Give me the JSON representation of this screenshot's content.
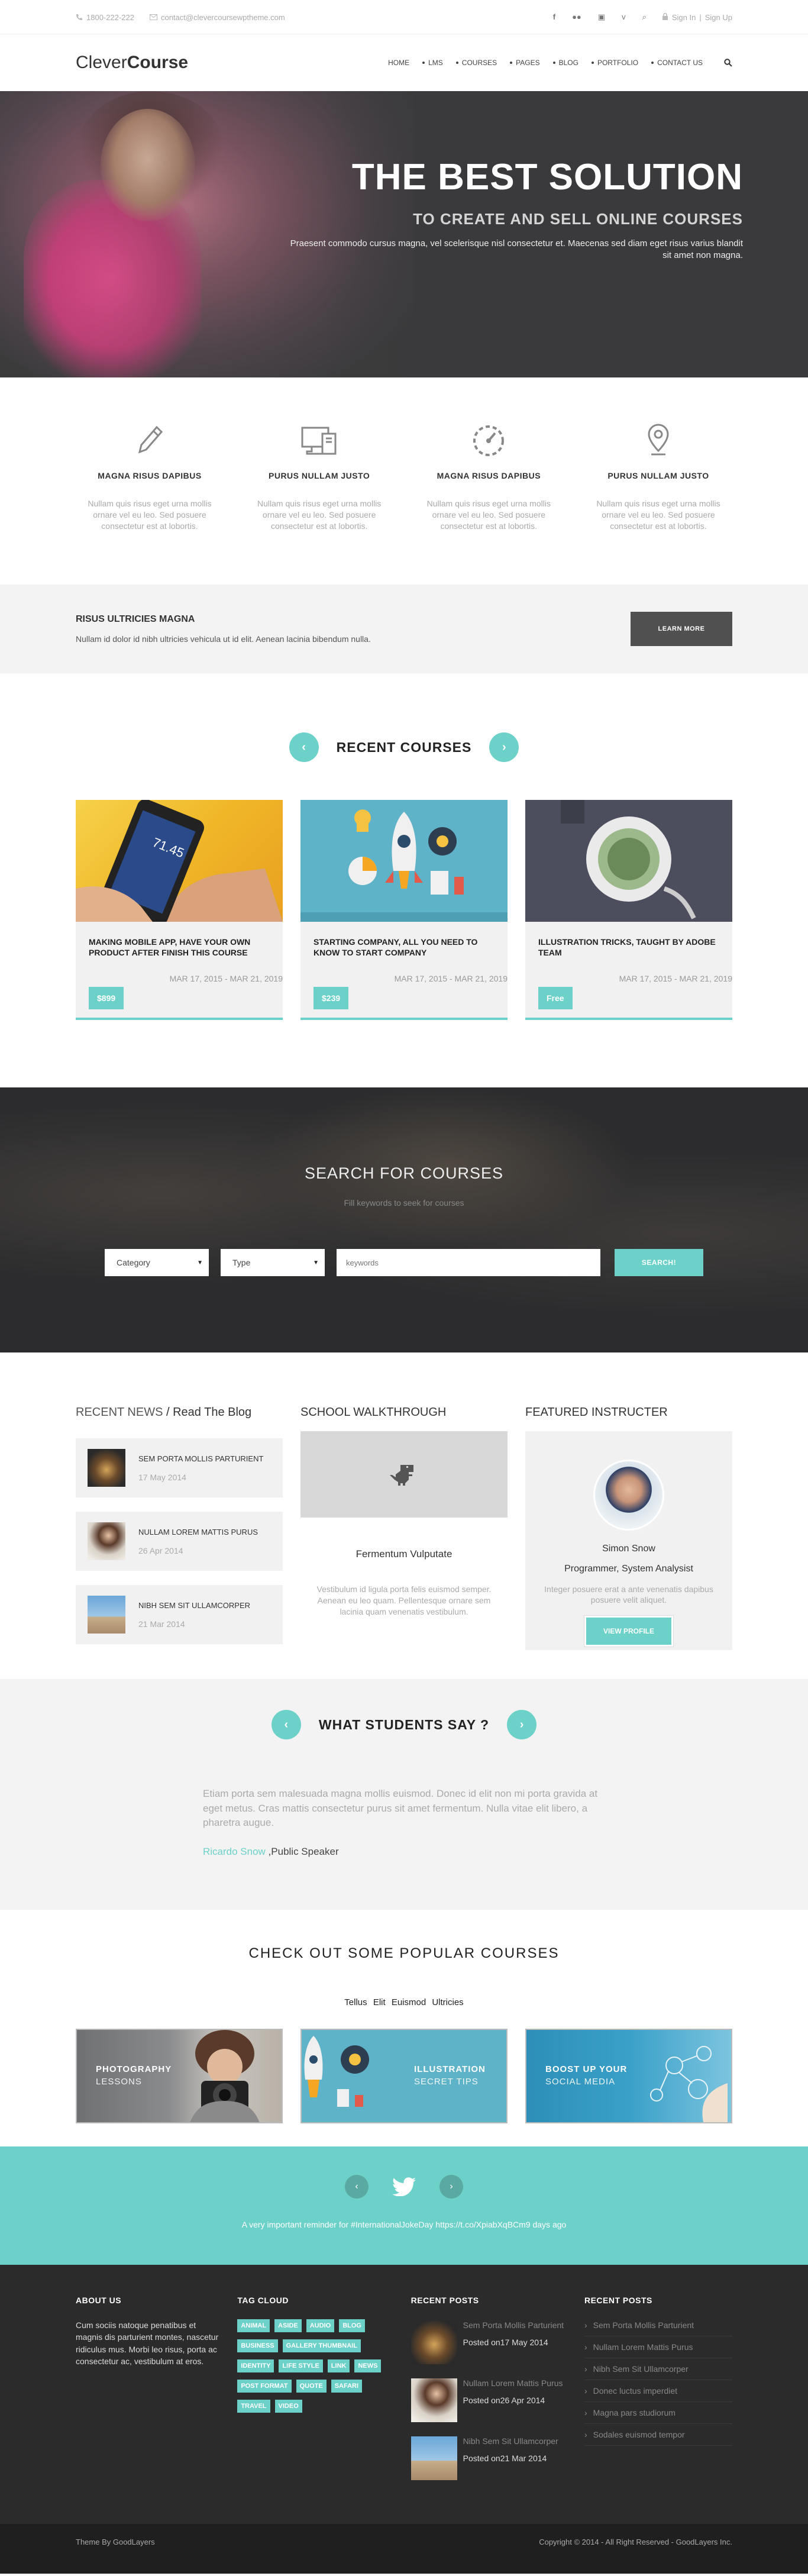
{
  "topbar": {
    "phone": "1800-222-222",
    "email": "contact@clevercoursewptheme.com",
    "sign_in": "Sign In",
    "separator": "|",
    "sign_up": "Sign Up",
    "social_icons": [
      "facebook-icon",
      "flickr-icon",
      "linkedin-icon",
      "vimeo-icon",
      "search-icon"
    ]
  },
  "header": {
    "logo_light": "Clever",
    "logo_bold": "Course",
    "nav": [
      "HOME",
      "LMS",
      "COURSES",
      "PAGES",
      "BLOG",
      "PORTFOLIO",
      "CONTACT US"
    ]
  },
  "hero": {
    "title": "THE BEST SOLUTION",
    "subtitle": "TO CREATE AND SELL ONLINE COURSES",
    "text": "Praesent commodo cursus magna, vel scelerisque nisl consectetur et. Maecenas sed diam eget risus varius blandit sit amet non magna."
  },
  "features": [
    {
      "icon": "pencil-icon",
      "title": "MAGNA RISUS DAPIBUS",
      "text": "Nullam quis risus eget urna mollis ornare vel eu leo. Sed posuere consectetur est at lobortis."
    },
    {
      "icon": "desktop-icon",
      "title": "PURUS NULLAM JUSTO",
      "text": "Nullam quis risus eget urna mollis ornare vel eu leo. Sed posuere consectetur est at lobortis."
    },
    {
      "icon": "dashboard-icon",
      "title": "MAGNA RISUS DAPIBUS",
      "text": "Nullam quis risus eget urna mollis ornare vel eu leo. Sed posuere consectetur est at lobortis."
    },
    {
      "icon": "location-pin-icon",
      "title": "PURUS NULLAM JUSTO",
      "text": "Nullam quis risus eget urna mollis ornare vel eu leo. Sed posuere consectetur est at lobortis."
    }
  ],
  "promo": {
    "title": "RISUS ULTRICIES MAGNA",
    "text": "Nullam id dolor id nibh ultricies vehicula ut id elit. Aenean lacinia bibendum nulla.",
    "button": "LEARN MORE"
  },
  "courses": {
    "title": "RECENT COURSES",
    "prev": "‹",
    "next": "›",
    "items": [
      {
        "title": "MAKING MOBILE APP, HAVE YOUR OWN PRODUCT AFTER FINISH THIS COURSE",
        "date": "MAR 17, 2015 - MAR 21, 2019",
        "price": "$899"
      },
      {
        "title": "STARTING COMPANY, ALL YOU NEED TO KNOW TO START COMPANY",
        "date": "MAR 17, 2015 - MAR 21, 2019",
        "price": "$239"
      },
      {
        "title": "ILLUSTRATION TRICKS, TAUGHT BY ADOBE TEAM",
        "date": "MAR 17, 2015 - MAR 21, 2019",
        "price": "Free"
      }
    ]
  },
  "search": {
    "title": "SEARCH FOR COURSES",
    "subtitle": "Fill keywords to seek for courses",
    "category": "Category",
    "type": "Type",
    "keywords_placeholder": "keywords",
    "button": "SEARCH!"
  },
  "news": {
    "title": "RECENT NEWS",
    "link": " / Read The Blog",
    "items": [
      {
        "title": "SEM PORTA MOLLIS PARTURIENT",
        "date": "17 May 2014"
      },
      {
        "title": "NULLAM LOREM MATTIS PURUS",
        "date": "26 Apr 2014"
      },
      {
        "title": "NIBH SEM SIT ULLAMCORPER",
        "date": "21 Mar 2014"
      }
    ]
  },
  "walkthrough": {
    "title": "SCHOOL WALKTHROUGH",
    "caption": "Fermentum Vulputate",
    "text": "Vestibulum id ligula porta felis euismod semper. Aenean eu leo quam. Pellentesque ornare sem lacinia quam venenatis vestibulum."
  },
  "instructor": {
    "title": "FEATURED INSTRUCTER",
    "name": "Simon Snow",
    "role": "Programmer, System Analysist",
    "text": "Integer posuere erat a ante venenatis dapibus posuere velit aliquet.",
    "button": "VIEW PROFILE"
  },
  "testimonials": {
    "title": "WHAT STUDENTS SAY ?",
    "prev": "‹",
    "next": "›",
    "text": "Etiam porta sem malesuada magna mollis euismod. Donec id elit non mi porta gravida at eget metus. Cras mattis consectetur purus sit amet fermentum. Nulla vitae elit libero, a pharetra augue.",
    "author": "Ricardo Snow",
    "author_role": " ,Public Speaker"
  },
  "popular": {
    "title": "CHECK OUT SOME POPULAR COURSES",
    "tags": "Tellus Elit Euismod Ultricies",
    "items": [
      {
        "title": "PHOTOGRAPHY",
        "sub": "LESSONS"
      },
      {
        "title": "ILLUSTRATION",
        "sub": "SECRET TIPS"
      },
      {
        "title": "BOOST UP YOUR",
        "sub": "SOCIAL MEDIA"
      }
    ]
  },
  "twitter": {
    "text": "A very important reminder for #InternationalJokeDay https://t.co/XpiabXqBCm9 days ago",
    "prev": "‹",
    "next": "›"
  },
  "footer": {
    "about_title": "ABOUT US",
    "about_text": "Cum sociis natoque penatibus et magnis dis parturient montes, nascetur ridiculus mus. Morbi leo risus, porta ac consectetur ac, vestibulum at eros.",
    "tag_title": "TAG CLOUD",
    "tags": [
      "ANIMAL",
      "ASIDE",
      "AUDIO",
      "BLOG",
      "BUSINESS",
      "GALLERY THUMBNAIL",
      "IDENTITY",
      "LIFE STYLE",
      "LINK",
      "NEWS",
      "POST FORMAT",
      "QUOTE",
      "SAFARI",
      "TRAVEL",
      "VIDEO"
    ],
    "posts_title": "RECENT POSTS",
    "posts": [
      {
        "title": "Sem Porta Mollis Parturient",
        "date": "Posted on17 May 2014"
      },
      {
        "title": "Nullam Lorem Mattis Purus",
        "date": "Posted on26 Apr 2014"
      },
      {
        "title": "Nibh Sem Sit Ullamcorper",
        "date": "Posted on21 Mar 2014"
      }
    ],
    "links_title": "RECENT POSTS",
    "links": [
      "Sem Porta Mollis Parturient",
      "Nullam Lorem Mattis Purus",
      "Nibh Sem Sit Ullamcorper",
      "Donec luctus imperdiet",
      "Magna pars studiorum",
      "Sodales euismod tempor"
    ]
  },
  "bottom": {
    "left": "Theme By GoodLayers",
    "right": "Copyright © 2014 - All Right Reserved - GoodLayers Inc."
  }
}
